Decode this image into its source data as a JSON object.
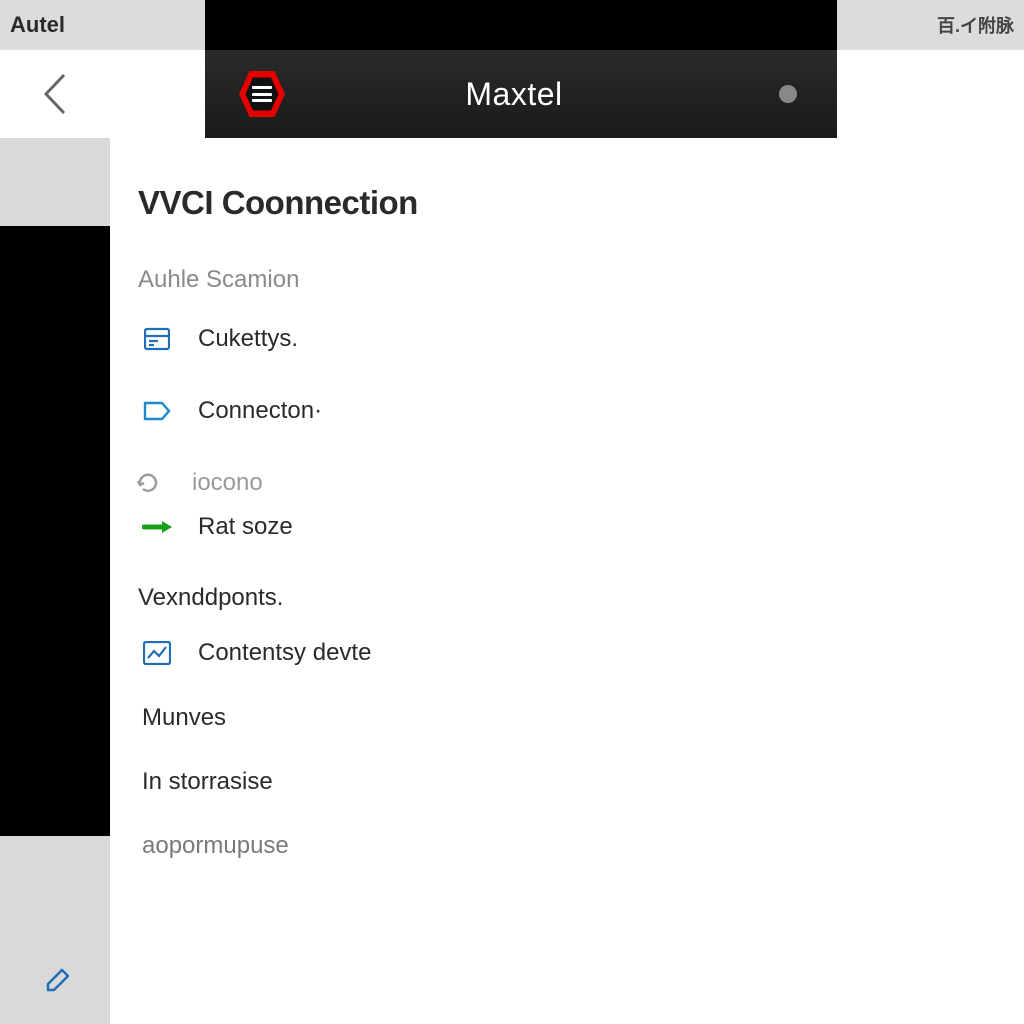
{
  "status": {
    "left": "Autel",
    "right": "百.イ附脉"
  },
  "header": {
    "title": "Maxtel"
  },
  "page": {
    "title": "VVCI Coonnection",
    "section1_label": "Auhle Scamion",
    "items1": [
      {
        "label": "Cukettys."
      },
      {
        "label": "Connecton·"
      }
    ],
    "section2_label": "iocono",
    "items2": [
      {
        "label": "Rat soze"
      }
    ],
    "section3_label": "Vexnddponts.",
    "items3": [
      {
        "label": "Contentsy devte"
      }
    ],
    "extra": [
      "Munves",
      "In storrasise",
      "aopormupuse"
    ]
  }
}
